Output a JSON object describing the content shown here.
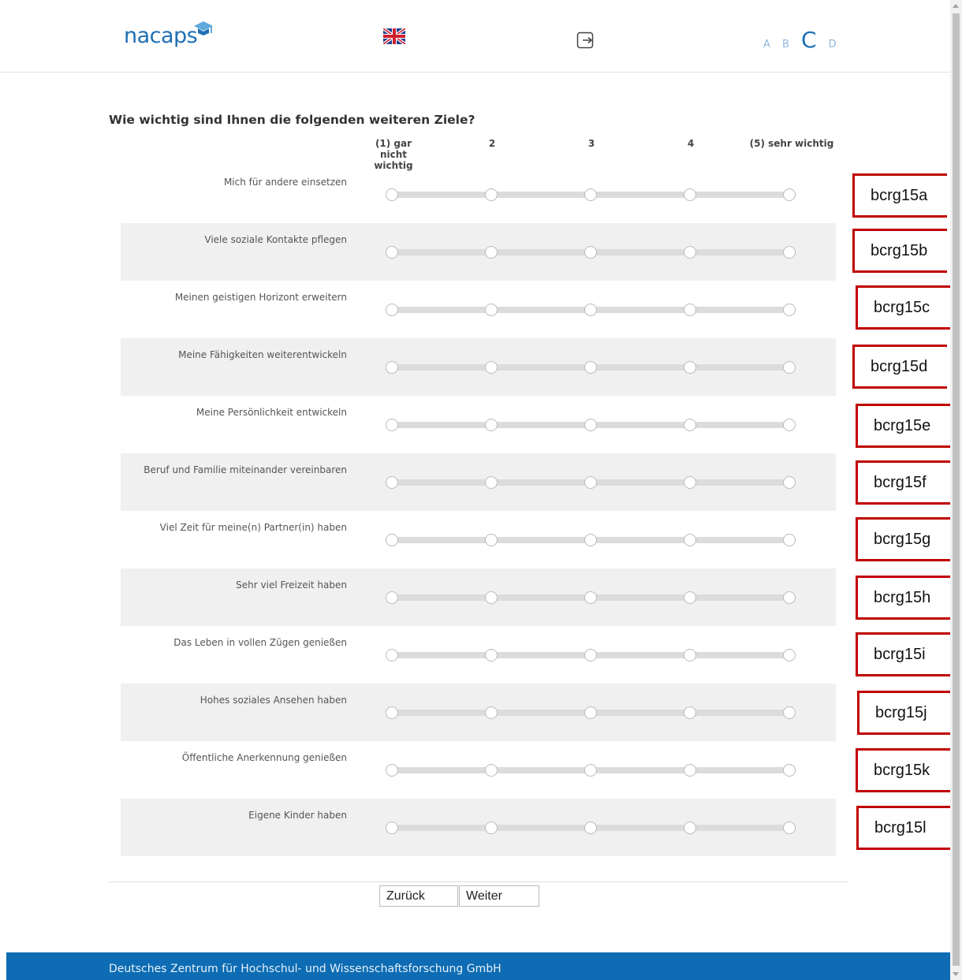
{
  "header": {
    "logo_text": "nacaps",
    "logo_icon": "graduation-cap-icon",
    "language_icon": "uk-flag-icon",
    "logout_icon": "logout-arrow-icon",
    "versions": [
      "A",
      "B",
      "C",
      "D"
    ],
    "active_version": "C"
  },
  "question": {
    "text": "Wie wichtig sind Ihnen die folgenden weiteren Ziele?",
    "scale": [
      {
        "label": "(1) gar nicht\nwichtig"
      },
      {
        "label": "2"
      },
      {
        "label": "3"
      },
      {
        "label": "4"
      },
      {
        "label": "(5) sehr wichtig"
      }
    ],
    "items": [
      {
        "label": "Mich für andere einsetzen",
        "var": "bcrg15a"
      },
      {
        "label": "Viele soziale Kontakte pflegen",
        "var": "bcrg15b"
      },
      {
        "label": "Meinen geistigen Horizont erweitern",
        "var": "bcrg15c"
      },
      {
        "label": "Meine Fähigkeiten weiterentwickeln",
        "var": "bcrg15d"
      },
      {
        "label": "Meine Persönlichkeit entwickeln",
        "var": "bcrg15e"
      },
      {
        "label": "Beruf und Familie miteinander vereinbaren",
        "var": "bcrg15f"
      },
      {
        "label": "Viel Zeit für meine(n) Partner(in) haben",
        "var": "bcrg15g"
      },
      {
        "label": "Sehr viel Freizeit haben",
        "var": "bcrg15h"
      },
      {
        "label": "Das Leben in vollen Zügen genießen",
        "var": "bcrg15i"
      },
      {
        "label": "Hohes soziales Ansehen haben",
        "var": "bcrg15j"
      },
      {
        "label": "Öffentliche Anerkennung genießen",
        "var": "bcrg15k"
      },
      {
        "label": "Eigene Kinder haben",
        "var": "bcrg15l"
      }
    ]
  },
  "nav": {
    "back_label": "Zurück",
    "next_label": "Weiter"
  },
  "footer": {
    "text": "Deutsches Zentrum für Hochschul- und Wissenschaftsforschung GmbH"
  }
}
